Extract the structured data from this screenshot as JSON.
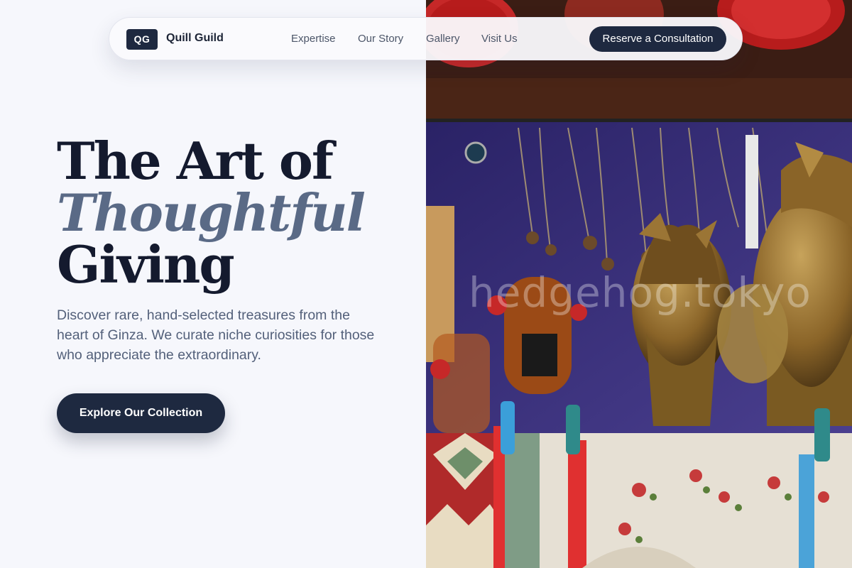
{
  "nav": {
    "logo_text": "QG",
    "brand": "Quill Guild",
    "links": [
      "Expertise",
      "Our Story",
      "Gallery",
      "Visit Us"
    ],
    "cta": "Reserve a Consultation"
  },
  "hero": {
    "headline_line1": "The Art of",
    "headline_line2": "Thoughtful",
    "headline_line3": "Giving",
    "description": "Discover rare, hand-selected treasures from the heart of Ginza. We curate niche curiosities for those who appreciate the extraordinary.",
    "cta": "Explore Our Collection"
  },
  "photo": {
    "watermark": "hedgehog.tokyo",
    "subject": "souvenir shop display with bronze busts, necklaces and embroidered textiles"
  },
  "colors": {
    "navy": "#1e2940",
    "accent_slate": "#5a6a86",
    "background": "#f6f7fc"
  }
}
